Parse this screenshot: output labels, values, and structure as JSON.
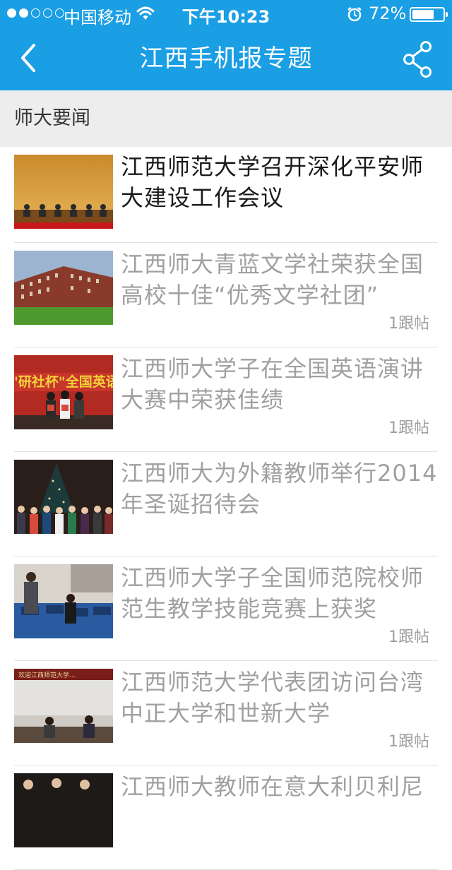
{
  "status_bar": {
    "carrier": "中国移动",
    "time": "下午10:23",
    "battery_text": "72%",
    "battery_level": 0.72,
    "signal_bars_filled": 2,
    "signal_bars_total": 5,
    "icons": [
      "wifi-icon",
      "alarm-icon",
      "battery-icon"
    ]
  },
  "nav": {
    "title": "江西手机报专题",
    "back_icon": "chevron-left-icon",
    "share_icon": "share-icon"
  },
  "section": {
    "title": "师大要闻"
  },
  "news": [
    {
      "title": "江西师范大学召开深化平安师大建设工作会议",
      "reply_count": ""
    },
    {
      "title": "江西师大青蓝文学社荣获全国高校十佳“优秀文学社团”",
      "reply_count": "1跟帖"
    },
    {
      "title": "江西师大学子在全国英语演讲大赛中荣获佳绩",
      "reply_count": "1跟帖"
    },
    {
      "title": "江西师大为外籍教师举行2014年圣诞招待会",
      "reply_count": ""
    },
    {
      "title": "江西师大学子全国师范院校师范生教学技能竞赛上获奖",
      "reply_count": "1跟帖"
    },
    {
      "title": "江西师范大学代表团访问台湾中正大学和世新大学",
      "reply_count": "1跟帖"
    },
    {
      "title": "江西师大教师在意大利贝利尼",
      "reply_count": ""
    }
  ],
  "thumbnail_banner_text": {
    "english_contest": "\"研社杯\"全国英语",
    "delegation": "欢迎江西师范大学..."
  },
  "colors": {
    "brand_blue": "#1a9ee4",
    "section_bg": "#ededed",
    "read_text": "#a0a0a0",
    "unread_text": "#1a1a1a"
  }
}
